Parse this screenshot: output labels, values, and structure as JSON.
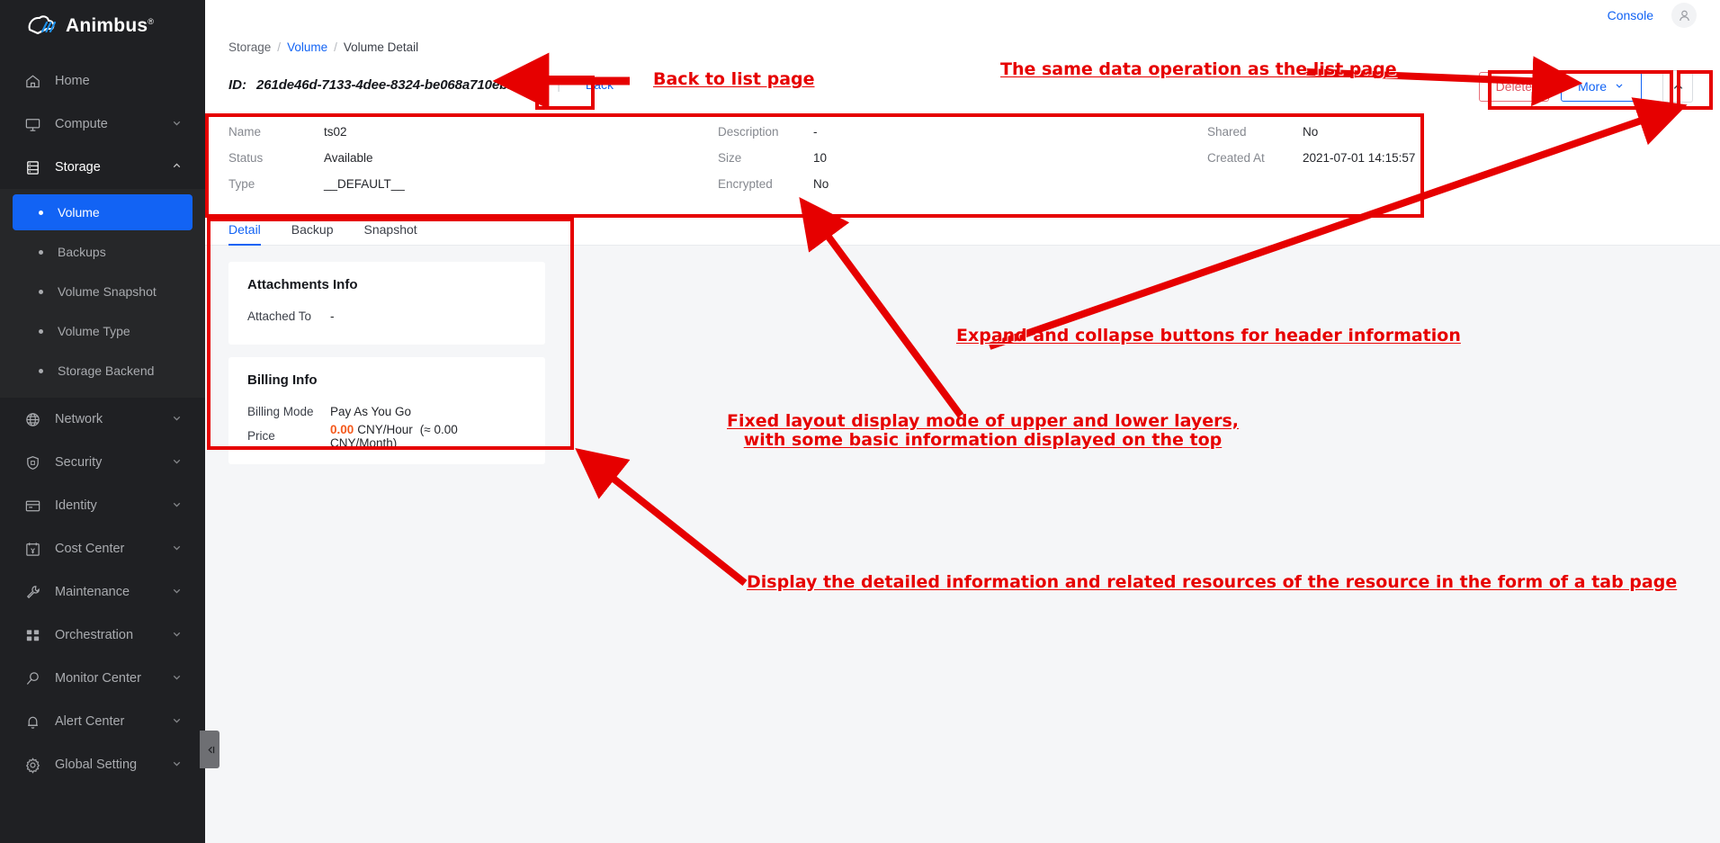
{
  "brand": {
    "name": "Animbus",
    "trademark": "®"
  },
  "topbar": {
    "console_label": "Console",
    "avatar_icon": "user-avatar-icon"
  },
  "sidebar": {
    "items": [
      {
        "label": "Home",
        "icon": "home-icon",
        "expandable": false,
        "open": false
      },
      {
        "label": "Compute",
        "icon": "monitor-icon",
        "expandable": true,
        "open": false
      },
      {
        "label": "Storage",
        "icon": "storage-stack-icon",
        "expandable": true,
        "open": true,
        "children": [
          {
            "label": "Volume",
            "active": true
          },
          {
            "label": "Backups",
            "active": false
          },
          {
            "label": "Volume Snapshot",
            "active": false
          },
          {
            "label": "Volume Type",
            "active": false
          },
          {
            "label": "Storage Backend",
            "active": false
          }
        ]
      },
      {
        "label": "Network",
        "icon": "globe-icon",
        "expandable": true,
        "open": false
      },
      {
        "label": "Security",
        "icon": "shield-icon",
        "expandable": true,
        "open": false
      },
      {
        "label": "Identity",
        "icon": "id-card-icon",
        "expandable": true,
        "open": false
      },
      {
        "label": "Cost Center",
        "icon": "calendar-cost-icon",
        "expandable": true,
        "open": false
      },
      {
        "label": "Maintenance",
        "icon": "wrench-icon",
        "expandable": true,
        "open": false
      },
      {
        "label": "Orchestration",
        "icon": "grid-blocks-icon",
        "expandable": true,
        "open": false
      },
      {
        "label": "Monitor Center",
        "icon": "magnifier-icon",
        "expandable": true,
        "open": false
      },
      {
        "label": "Alert Center",
        "icon": "bell-icon",
        "expandable": true,
        "open": false
      },
      {
        "label": "Global Setting",
        "icon": "gear-icon",
        "expandable": true,
        "open": false
      }
    ],
    "collapse_handle_icon": "collapse-sidebar-icon"
  },
  "breadcrumb": {
    "root": "Storage",
    "sep": "/",
    "link": "Volume",
    "current": "Volume Detail"
  },
  "header": {
    "id_label": "ID:",
    "id_value": "261de46d-7133-4dee-8324-be068a710ebb",
    "copy_icon": "copy-icon",
    "divider": "|",
    "back_label": "Back",
    "delete_label": "Delete",
    "more_label": "More",
    "more_chevron_icon": "chevron-down-icon",
    "collapse_icon": "chevron-up-icon"
  },
  "info": {
    "rows": [
      {
        "key": "Name",
        "value": "ts02"
      },
      {
        "key": "Status",
        "value": "Available"
      },
      {
        "key": "Type",
        "value": "__DEFAULT__"
      },
      {
        "key": "Description",
        "value": "-"
      },
      {
        "key": "Size",
        "value": "10"
      },
      {
        "key": "Encrypted",
        "value": "No"
      },
      {
        "key": "Shared",
        "value": "No"
      },
      {
        "key": "Created At",
        "value": "2021-07-01 14:15:57"
      }
    ]
  },
  "tabs": [
    {
      "label": "Detail",
      "active": true
    },
    {
      "label": "Backup",
      "active": false
    },
    {
      "label": "Snapshot",
      "active": false
    }
  ],
  "cards": [
    {
      "title": "Attachments Info",
      "rows": [
        {
          "key": "Attached To",
          "value": "-"
        }
      ]
    },
    {
      "title": "Billing Info",
      "rows": [
        {
          "key": "Billing Mode",
          "value": "Pay As You Go"
        }
      ],
      "price": {
        "key": "Price",
        "amount": "0.00",
        "unit": "CNY/Hour",
        "approx": "(≈ 0.00 CNY/Month)"
      }
    }
  ],
  "annotations": [
    {
      "id": "a1",
      "text": "Back to list page"
    },
    {
      "id": "a2",
      "text": "The same data operation as the list page"
    },
    {
      "id": "a3",
      "text": "Expand and collapse buttons for header information"
    },
    {
      "id": "a4",
      "text": "Fixed layout display mode of upper and lower layers,\nwith some basic information displayed on the top"
    },
    {
      "id": "a5",
      "text": "Display the detailed information and related resources of the resource in the form of a tab page"
    }
  ],
  "colors": {
    "accent_blue": "#1263f4",
    "sidebar_bg": "#1f2023",
    "annotation_red": "#e60000",
    "price_orange": "#f4591c",
    "delete_red": "#e2515d",
    "page_bg": "#f5f6f8"
  }
}
